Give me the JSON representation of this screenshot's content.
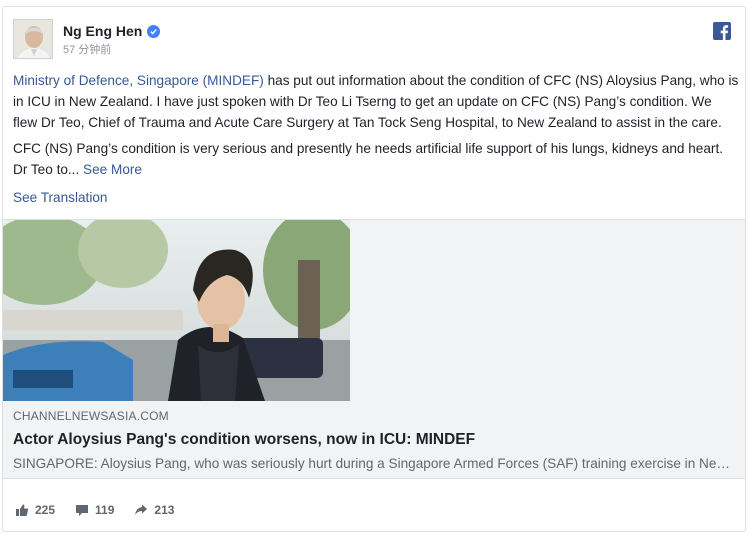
{
  "post": {
    "author": "Ng Eng Hen",
    "timestamp": "57 分钟前",
    "paragraph1_link": "Ministry of Defence, Singapore (MINDEF)",
    "paragraph1_rest": " has put out information about the condition of CFC (NS) Aloysius Pang, who is in ICU in New Zealand. I have just spoken with Dr Teo Li Tserng to get an update on CFC (NS) Pang’s condition. We flew Dr Teo, Chief of Trauma and Acute Care Surgery at Tan Tock Seng Hospital, to New Zealand to assist in the care.",
    "paragraph2": "CFC (NS) Pang’s condition is very serious and presently he needs artificial life support of his lungs, kidneys and heart. Dr Teo to...",
    "see_more": "See More",
    "see_translation": "See Translation"
  },
  "link_preview": {
    "domain": "CHANNELNEWSASIA.COM",
    "headline": "Actor Aloysius Pang's condition worsens, now in ICU: MINDEF",
    "snippet": "SINGAPORE: Aloysius Pang, who was seriously hurt during a Singapore Armed Forces (SAF) training exercise in New Zealand"
  },
  "reactions": {
    "likes": "225",
    "comments": "119",
    "shares": "213"
  },
  "colors": {
    "link": "#385898",
    "facebook_blue": "#3b5998",
    "verified": "#4080ff"
  },
  "icons": [
    "verified-badge-icon",
    "facebook-logo-icon",
    "thumbs-up-icon",
    "comment-icon",
    "share-icon"
  ]
}
